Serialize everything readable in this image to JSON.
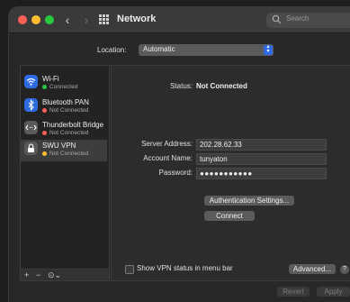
{
  "window": {
    "title": "Network",
    "search_placeholder": "Search"
  },
  "location": {
    "label": "Location:",
    "value": "Automatic"
  },
  "services": [
    {
      "name": "Wi-Fi",
      "status": "Connected",
      "status_color": "#28c840",
      "icon": "wifi-icon",
      "icon_color": "#2e6be3"
    },
    {
      "name": "Bluetooth PAN",
      "status": "Not Connected",
      "status_color": "#fe5f57",
      "icon": "bluetooth-icon",
      "icon_color": "#2e6be3"
    },
    {
      "name": "Thunderbolt Bridge",
      "status": "Not Connected",
      "status_color": "#fe5f57",
      "icon": "thunderbolt-bridge-icon",
      "icon_color": "#5a5a5a"
    },
    {
      "name": "SWU VPN",
      "status": "Not Connected",
      "status_color": "#febc2e",
      "icon": "vpn-lock-icon",
      "icon_color": "#5a5a5a"
    }
  ],
  "sidebar_footer": {
    "add": "+",
    "remove": "−",
    "action": "⊙⌄"
  },
  "detail": {
    "status_label": "Status:",
    "status_value": "Not Connected",
    "server_label": "Server Address:",
    "server_value": "202.28.62.33",
    "account_label": "Account Name:",
    "account_value": "tunyaton",
    "password_label": "Password:",
    "password_value": "●●●●●●●●●●●",
    "auth_button": "Authentication Settings...",
    "connect_button": "Connect",
    "show_vpn_label": "Show VPN status in menu bar",
    "advanced_button": "Advanced...",
    "help_button": "?"
  },
  "footer": {
    "revert": "Revert",
    "apply": "Apply"
  },
  "colors": {
    "accent": "#2e6be3",
    "connected": "#28c840",
    "not_connected": "#fe5f57",
    "vpn_idle": "#febc2e"
  }
}
